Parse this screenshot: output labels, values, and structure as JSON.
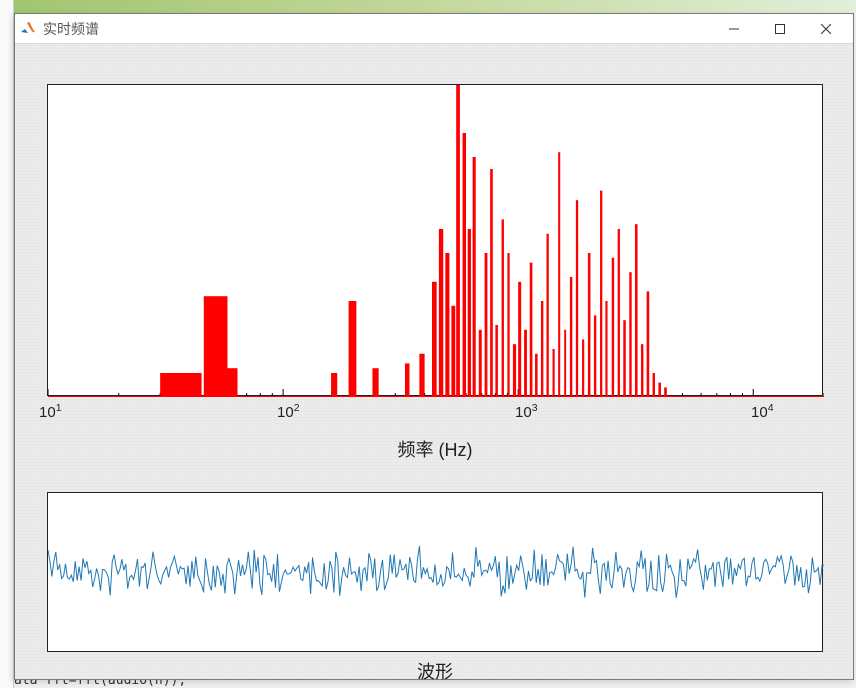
{
  "window": {
    "title": "实时频谱",
    "minimize_tooltip": "Minimize",
    "maximize_tooltip": "Maximize",
    "close_tooltip": "Close"
  },
  "spectrum": {
    "xlabel": "频率 (Hz)",
    "tick_labels": [
      "10^1",
      "10^2",
      "10^3",
      "10^4"
    ]
  },
  "waveform": {
    "xlabel": "波形"
  },
  "background_code_snippet": "ata fft=fft(audio(n));",
  "chart_data": [
    {
      "type": "bar",
      "title": "实时频谱",
      "xlabel": "频率 (Hz)",
      "ylabel": "",
      "xscale": "log",
      "xlim": [
        10,
        20000
      ],
      "ylim": [
        0,
        130
      ],
      "bars": [
        {
          "x1": 30,
          "x2": 45,
          "h": 10
        },
        {
          "x1": 46,
          "x2": 58,
          "h": 42
        },
        {
          "x1": 56,
          "x2": 64,
          "h": 12
        },
        {
          "x1": 160,
          "x2": 170,
          "h": 10
        },
        {
          "x1": 190,
          "x2": 205,
          "h": 40
        },
        {
          "x1": 240,
          "x2": 255,
          "h": 12
        },
        {
          "x1": 330,
          "x2": 345,
          "h": 14
        },
        {
          "x1": 380,
          "x2": 400,
          "h": 18
        },
        {
          "x1": 430,
          "x2": 450,
          "h": 48
        },
        {
          "x1": 460,
          "x2": 480,
          "h": 70
        },
        {
          "x1": 490,
          "x2": 510,
          "h": 60
        },
        {
          "x1": 520,
          "x2": 540,
          "h": 38
        },
        {
          "x1": 545,
          "x2": 565,
          "h": 130
        },
        {
          "x1": 580,
          "x2": 600,
          "h": 110
        },
        {
          "x1": 610,
          "x2": 630,
          "h": 70
        },
        {
          "x1": 640,
          "x2": 660,
          "h": 100
        },
        {
          "x1": 680,
          "x2": 700,
          "h": 28
        },
        {
          "x1": 720,
          "x2": 740,
          "h": 60
        },
        {
          "x1": 760,
          "x2": 780,
          "h": 95
        },
        {
          "x1": 800,
          "x2": 820,
          "h": 30
        },
        {
          "x1": 850,
          "x2": 870,
          "h": 74
        },
        {
          "x1": 900,
          "x2": 920,
          "h": 60
        },
        {
          "x1": 950,
          "x2": 980,
          "h": 22
        },
        {
          "x1": 1000,
          "x2": 1030,
          "h": 48
        },
        {
          "x1": 1060,
          "x2": 1090,
          "h": 28
        },
        {
          "x1": 1120,
          "x2": 1150,
          "h": 56
        },
        {
          "x1": 1180,
          "x2": 1210,
          "h": 18
        },
        {
          "x1": 1250,
          "x2": 1280,
          "h": 40
        },
        {
          "x1": 1320,
          "x2": 1350,
          "h": 68
        },
        {
          "x1": 1400,
          "x2": 1430,
          "h": 20
        },
        {
          "x1": 1480,
          "x2": 1510,
          "h": 102
        },
        {
          "x1": 1570,
          "x2": 1600,
          "h": 28
        },
        {
          "x1": 1660,
          "x2": 1700,
          "h": 50
        },
        {
          "x1": 1760,
          "x2": 1800,
          "h": 82
        },
        {
          "x1": 1870,
          "x2": 1910,
          "h": 24
        },
        {
          "x1": 1980,
          "x2": 2030,
          "h": 60
        },
        {
          "x1": 2100,
          "x2": 2150,
          "h": 34
        },
        {
          "x1": 2230,
          "x2": 2280,
          "h": 86
        },
        {
          "x1": 2350,
          "x2": 2400,
          "h": 40
        },
        {
          "x1": 2500,
          "x2": 2560,
          "h": 58
        },
        {
          "x1": 2650,
          "x2": 2710,
          "h": 70
        },
        {
          "x1": 2800,
          "x2": 2870,
          "h": 32
        },
        {
          "x1": 2970,
          "x2": 3040,
          "h": 52
        },
        {
          "x1": 3140,
          "x2": 3220,
          "h": 72
        },
        {
          "x1": 3330,
          "x2": 3410,
          "h": 22
        },
        {
          "x1": 3520,
          "x2": 3610,
          "h": 44
        },
        {
          "x1": 3730,
          "x2": 3820,
          "h": 10
        },
        {
          "x1": 3950,
          "x2": 4050,
          "h": 6
        },
        {
          "x1": 4180,
          "x2": 4290,
          "h": 4
        }
      ]
    },
    {
      "type": "line",
      "title": "波形",
      "xlabel": "波形",
      "ylabel": "",
      "xlim": [
        0,
        1
      ],
      "ylim": [
        -1,
        1
      ],
      "note": "random-noise-like audio waveform, ~400 samples, amplitude roughly ±0.4",
      "series": [
        {
          "name": "audio",
          "amplitude": 0.4,
          "n_samples": 400
        }
      ]
    }
  ]
}
